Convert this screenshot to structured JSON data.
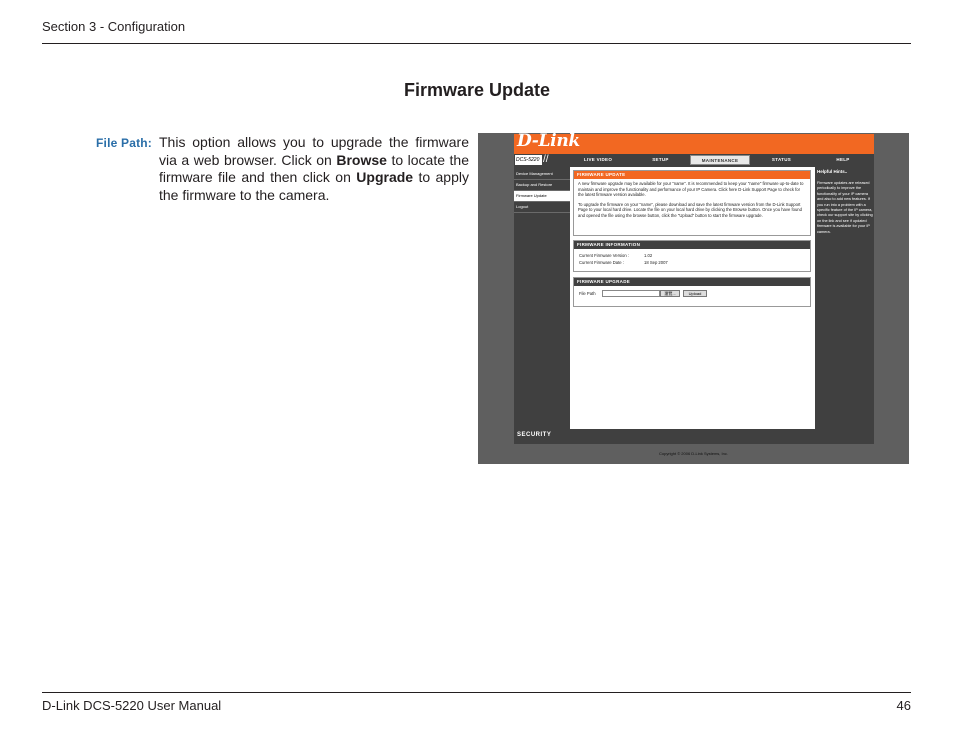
{
  "header": {
    "section": "Section 3 - Configuration"
  },
  "title": "Firmware Update",
  "label": "File Path:",
  "description": {
    "t1": "This option allows you to upgrade the firmware via a web browser. Click on ",
    "b1": "Browse",
    "t2": " to locate the firmware file and then click on ",
    "b2": "Upgrade",
    "t3": " to apply the firmware to the camera."
  },
  "screenshot": {
    "logo": "D-Link",
    "model": "DCS-5220",
    "tabs": [
      "LIVE VIDEO",
      "SETUP",
      "MAINTENANCE",
      "STATUS",
      "HELP"
    ],
    "active_tab": "MAINTENANCE",
    "links": [
      "Device Management",
      "Backup and Restore",
      "Firmware Update",
      "Logout"
    ],
    "fw_heading": "FIRMWARE UPDATE",
    "fw_p1": "A new firmware upgrade may be available for your \"name\". It is recommended to keep your \"name\" firmware up-to-date to maintain and improve the functionality and performance of your IP Camera. Click here D-Link Support Page to check for the latest firmware version available.",
    "fw_p2": "To upgrade the firmware on your \"name\", please download and save the latest firmware version from the D-Link Support Page to your local hard drive. Locate the file on your local hard drive by clicking the Browse button. Once you have found and opened the file using the browse button, click the \"Upload\" button to start the firmware upgrade.",
    "info_heading": "FIRMWARE INFORMATION",
    "cur_ver_label": "Current Firmware Version :",
    "cur_ver": "1.02",
    "cur_date_label": "Current Firmware Date :",
    "cur_date": "18 Sep 2007",
    "upg_heading": "FIRMWARE UPGRADE",
    "file_path_label": "File Path",
    "browse_btn": "瀏覽...",
    "upload_btn": "Upload",
    "hints_heading": "Helpful Hints..",
    "hints": "Firmware updates are released periodically to improve the functionality of your IP camera and also to add new features. If you run into a problem with a specific feature of the IP camera, check our support site by clicking on the link and see if updated firmware is available for your IP camera.",
    "footer_brand": "SECURITY",
    "copyright": "Copyright © 2006 D-Link Systems, Inc."
  },
  "footer": {
    "manual": "D-Link DCS-5220 User Manual",
    "page": "46"
  }
}
